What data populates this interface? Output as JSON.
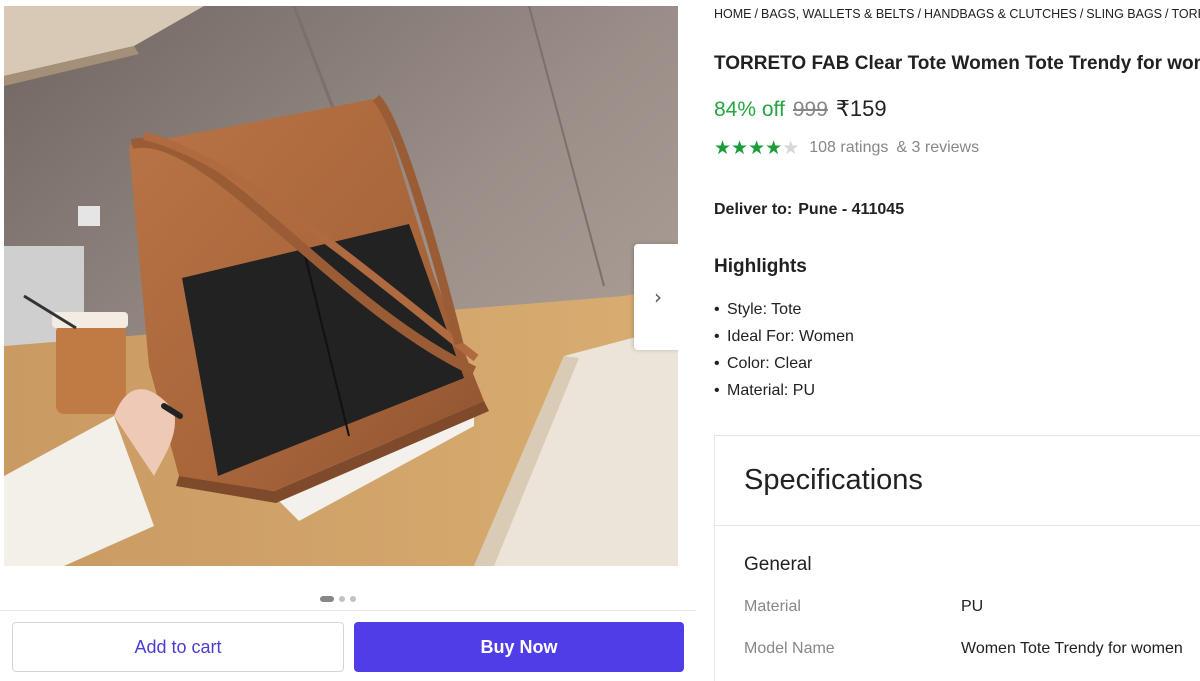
{
  "gallery": {
    "next_icon": "chevron-right-icon",
    "next_glyph": "›",
    "image_count": 3,
    "active_index": 0
  },
  "actions": {
    "add_to_cart": "Add to cart",
    "buy_now": "Buy Now"
  },
  "breadcrumb": [
    "HOME",
    "BAGS, WALLETS & BELTS",
    "HANDBAGS & CLUTCHES",
    "SLING BAGS",
    "TORRETO FAB"
  ],
  "product": {
    "title": "TORRETO FAB Clear Tote Women Tote Trendy for women",
    "discount": "84% off",
    "mrp": "999",
    "price": "₹159",
    "rating": 4,
    "rating_max": 5,
    "ratings_text": "108 ratings",
    "reviews_text": "& 3 reviews"
  },
  "delivery": {
    "label": "Deliver to:",
    "location": "Pune - 411045"
  },
  "highlights": {
    "title": "Highlights",
    "items": [
      "Style: Tote",
      "Ideal For: Women",
      "Color: Clear",
      "Material: PU"
    ]
  },
  "specifications": {
    "title": "Specifications",
    "group": "General",
    "rows": [
      {
        "key": "Material",
        "value": "PU"
      },
      {
        "key": "Model Name",
        "value": "Women Tote Trendy for women"
      }
    ]
  },
  "colors": {
    "accent": "#4f3ee8",
    "discount_green": "#26a541",
    "star_green": "#1a9c3b",
    "muted": "#878787"
  }
}
